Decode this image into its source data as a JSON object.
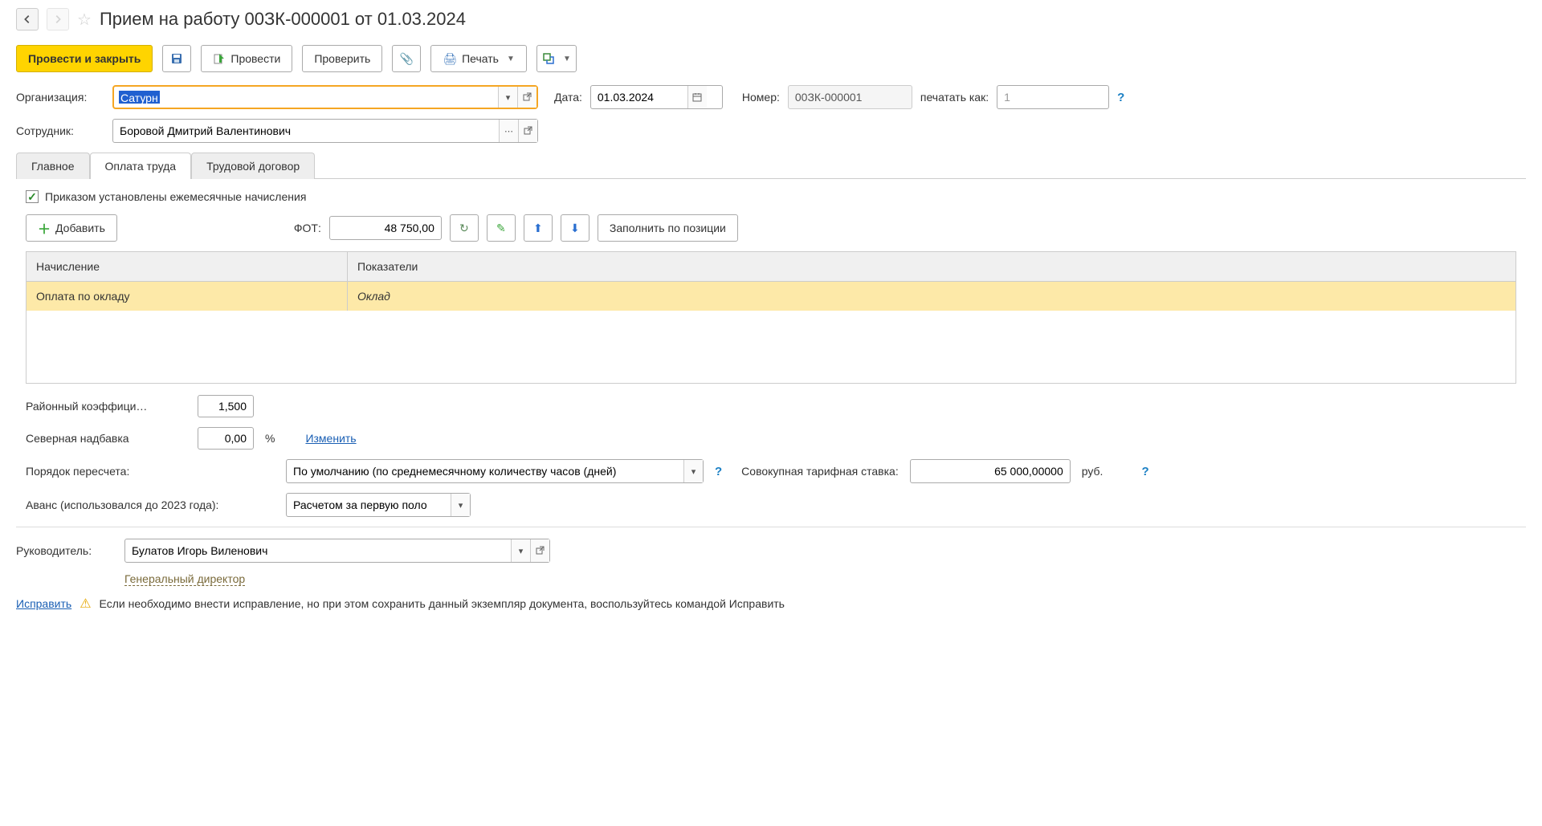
{
  "title": "Прием на работу 00ЗК-000001 от 01.03.2024",
  "toolbar": {
    "post_close": "Провести и закрыть",
    "post": "Провести",
    "check": "Проверить",
    "print": "Печать"
  },
  "org": {
    "label": "Организация:",
    "value": "Сатурн"
  },
  "date": {
    "label": "Дата:",
    "value": "01.03.2024"
  },
  "number": {
    "label": "Номер:",
    "value": "00ЗК-000001",
    "print_as_label": "печатать как:",
    "print_as_value": "1"
  },
  "employee": {
    "label": "Сотрудник:",
    "value": "Боровой Дмитрий Валентинович"
  },
  "tabs": {
    "main": "Главное",
    "pay": "Оплата труда",
    "contract": "Трудовой договор"
  },
  "monthly_checkbox": "Приказом установлены ежемесячные начисления",
  "accrual_toolbar": {
    "add": "Добавить",
    "fot_label": "ФОТ:",
    "fot_value": "48 750,00",
    "fill_by_position": "Заполнить по позиции"
  },
  "table": {
    "col_accrual": "Начисление",
    "col_indicators": "Показатели",
    "row1_accrual": "Оплата по окладу",
    "row1_indicator": "Оклад"
  },
  "district_coeff": {
    "label": "Районный коэффици…",
    "value": "1,500"
  },
  "north": {
    "label": "Северная надбавка",
    "value": "0,00",
    "pct": "%",
    "change": "Изменить"
  },
  "recalc": {
    "label": "Порядок пересчета:",
    "value": "По умолчанию (по среднемесячному количеству часов (дней)"
  },
  "tariff": {
    "label": "Совокупная тарифная ставка:",
    "value": "65 000,00000",
    "unit": "руб."
  },
  "advance": {
    "label": "Аванс (использовался до 2023 года):",
    "value": "Расчетом за первую поло"
  },
  "manager": {
    "label": "Руководитель:",
    "value": "Булатов Игорь Виленович",
    "position": "Генеральный директор "
  },
  "fix": {
    "link": "Исправить",
    "text": "Если необходимо внести исправление, но при этом сохранить данный экземпляр документа, воспользуйтесь командой Исправить"
  }
}
